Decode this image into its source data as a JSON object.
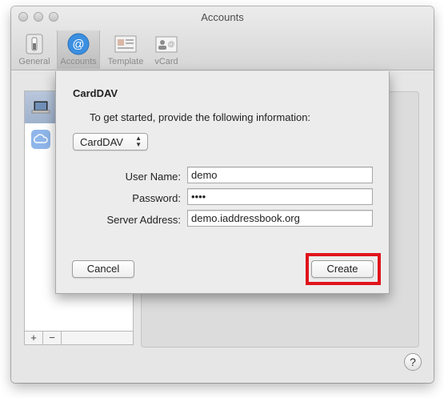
{
  "window": {
    "title": "Accounts"
  },
  "toolbar": {
    "items": [
      {
        "label": "General",
        "icon": "switch-icon"
      },
      {
        "label": "Accounts",
        "icon": "at-sign-icon"
      },
      {
        "label": "Template",
        "icon": "template-card-icon"
      },
      {
        "label": "vCard",
        "icon": "vcard-icon"
      }
    ]
  },
  "accounts_list": {
    "add_label": "+",
    "remove_label": "−",
    "items": [
      {
        "icon": "laptop-icon"
      },
      {
        "icon": "cloud-icon"
      }
    ]
  },
  "help": {
    "label": "?"
  },
  "sheet": {
    "title": "CardDAV",
    "message": "To get started, provide the following information:",
    "account_type": "CardDAV",
    "fields": {
      "user_name_label": "User Name:",
      "user_name_value": "demo",
      "password_label": "Password:",
      "password_value": "••••",
      "server_label": "Server Address:",
      "server_value": "demo.iaddressbook.org"
    },
    "cancel_label": "Cancel",
    "create_label": "Create"
  },
  "colors": {
    "highlight": "#e0141c",
    "accent": "#3b8fe0"
  }
}
